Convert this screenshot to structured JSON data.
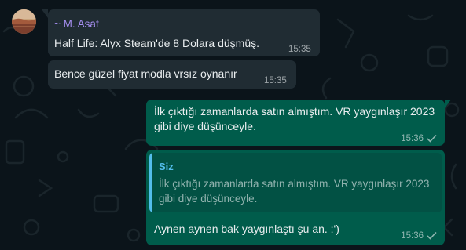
{
  "chat": {
    "messages": [
      {
        "direction": "incoming",
        "sender": "~ M. Asaf",
        "text": "Half Life: Alyx Steam'de 8 Dolara düşmüş.",
        "time": "15:35",
        "avatar_icon": "profile-photo"
      },
      {
        "direction": "incoming",
        "text": "Bence güzel fiyat modla vrsız oynanır",
        "time": "15:35"
      },
      {
        "direction": "outgoing",
        "text": "İlk çıktığı zamanlarda satın almıştım. VR yaygınlaşır 2023 gibi diye düşünceyle.",
        "time": "15:36",
        "status_icon": "single-check-icon"
      },
      {
        "direction": "outgoing",
        "quote": {
          "sender": "Siz",
          "text": "İlk çıktığı zamanlarda satın almıştım. VR yaygınlaşır 2023 gibi diye düşünceyle."
        },
        "text": "Aynen aynen bak yaygınlaştı şu an. :')",
        "time": "15:36",
        "status_icon": "single-check-icon"
      }
    ]
  },
  "colors": {
    "background": "#0b141a",
    "incoming_bubble": "#202c33",
    "outgoing_bubble": "#005c4b",
    "quote_background": "#025144",
    "quote_accent": "#53bdeb",
    "sender_name": "#a58ef0"
  }
}
